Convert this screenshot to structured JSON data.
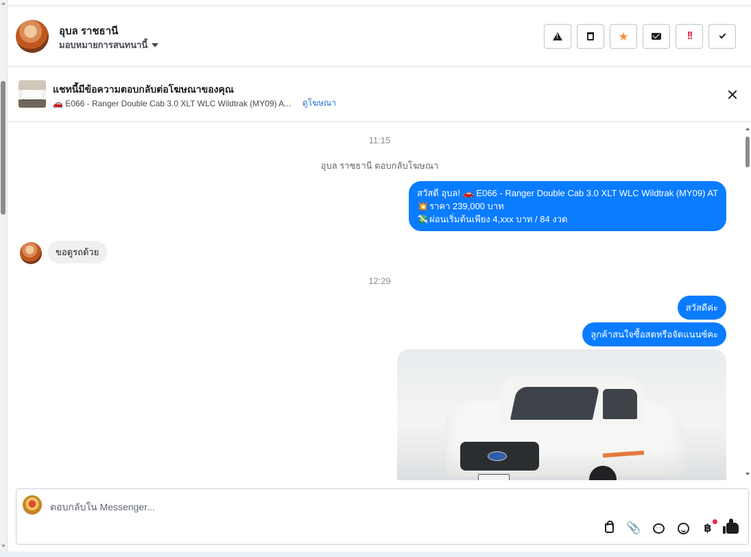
{
  "header": {
    "contact_name": "อุบล ราชธานี",
    "assign_label": "มอบหมายการสนทนานี้"
  },
  "ad": {
    "title": "แชทนี้มีข้อความตอบกลับต่อโฆษณาของคุณ",
    "description": "🚗 E066 - Ranger Double Cab 3.0 XLT WLC Wildtrak (MY09) AT ...",
    "link_label": "ดูโฆษณา"
  },
  "chat": {
    "time1": "11:15",
    "reply_note": "อุบล ราชธานี ตอบกลับโฆษณา",
    "out1": {
      "line1": "สวัสดี อุบล! 🚗 E066 - Ranger Double Cab 3.0 XLT WLC Wildtrak (MY09) AT",
      "line2_icon": "💥",
      "line2": "ราคา 239,000 บาท",
      "line3_icon": "💸",
      "line3": "ผ่อนเริ่มต้นเพียง 4,xxx บาท / 84 งวด"
    },
    "in1": "ขอดูรถด้วย",
    "time2": "12:29",
    "out2": "สวัสดีค่ะ",
    "out3": "ลูกค้าสนใจซื้อสดหรือจัดแนนซ์คะ"
  },
  "composer": {
    "placeholder": "ตอบกลับใน Messenger...",
    "baht_symbol": "฿"
  },
  "colors": {
    "accent": "#0a7cff",
    "link": "#216fdb",
    "star": "#f7923b",
    "danger": "#e41e3f"
  }
}
